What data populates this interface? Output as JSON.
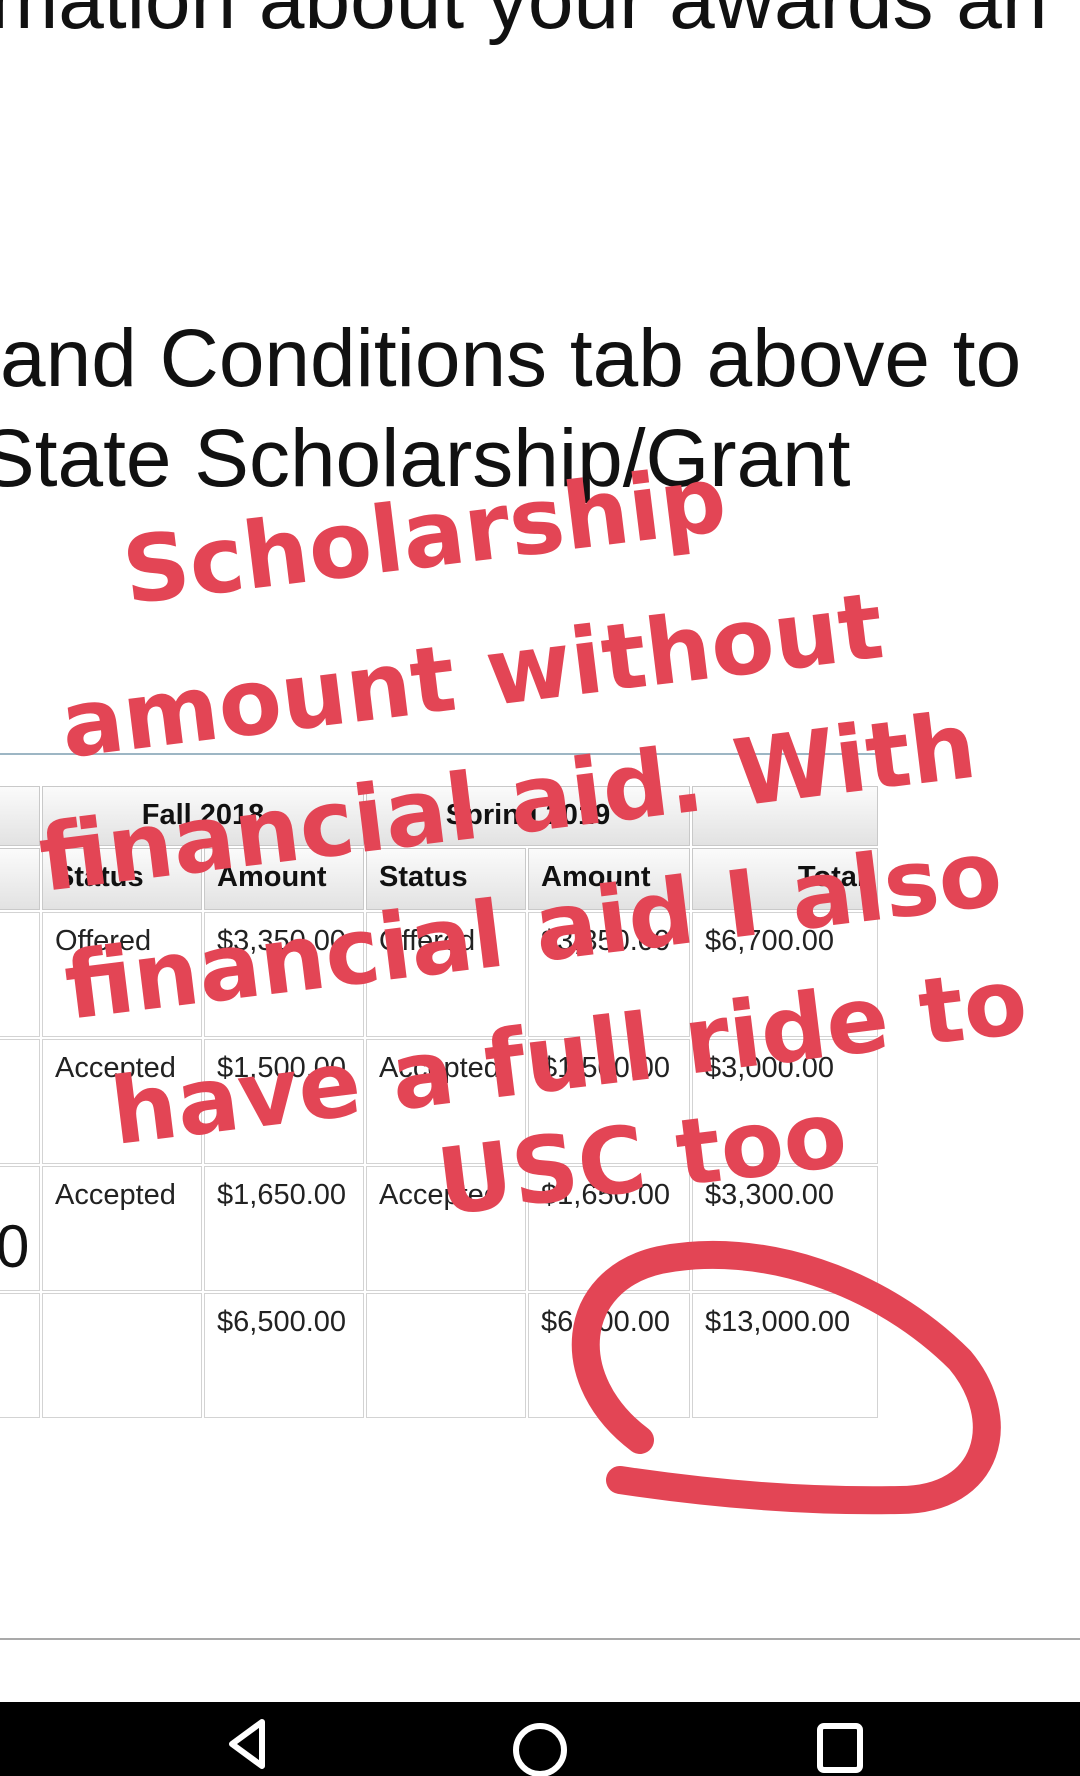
{
  "page": {
    "line1": "mation about your awards an",
    "line2": "and Conditions tab above to",
    "line3": "State Scholarship/Grant"
  },
  "table": {
    "term_headers": [
      "Fall 2018",
      "Spring 2019"
    ],
    "column_headers": [
      "Status",
      "Amount",
      "Status",
      "Amount",
      "Total"
    ],
    "rows": [
      {
        "fall_status": "Offered",
        "fall_amount": "$3,350.00",
        "spring_status": "Offered",
        "spring_amount": "$3,350.00",
        "total": "$6,700.00"
      },
      {
        "fall_status": "Accepted",
        "fall_amount": "$1,500.00",
        "spring_status": "Accepted",
        "spring_amount": "$1,500.00",
        "total": "$3,000.00"
      },
      {
        "fall_status": "Accepted",
        "fall_amount": "$1,650.00",
        "spring_status": "Accepted",
        "spring_amount": "$1,650.00",
        "total": "$3,300.00"
      },
      {
        "fall_status": "",
        "fall_amount": "$6,500.00",
        "spring_status": "",
        "spring_amount": "$6,500.00",
        "total": "$13,000.00"
      }
    ],
    "left_edge_char": "0"
  },
  "annotation": {
    "lines": [
      "Scholarship",
      "amount without",
      "financial aid. With",
      "financial aid I also",
      "have a full ride to",
      "USC too"
    ],
    "color": "#e34555"
  },
  "navbar": {
    "buttons": [
      "back-icon",
      "home-icon",
      "recents-icon"
    ]
  }
}
